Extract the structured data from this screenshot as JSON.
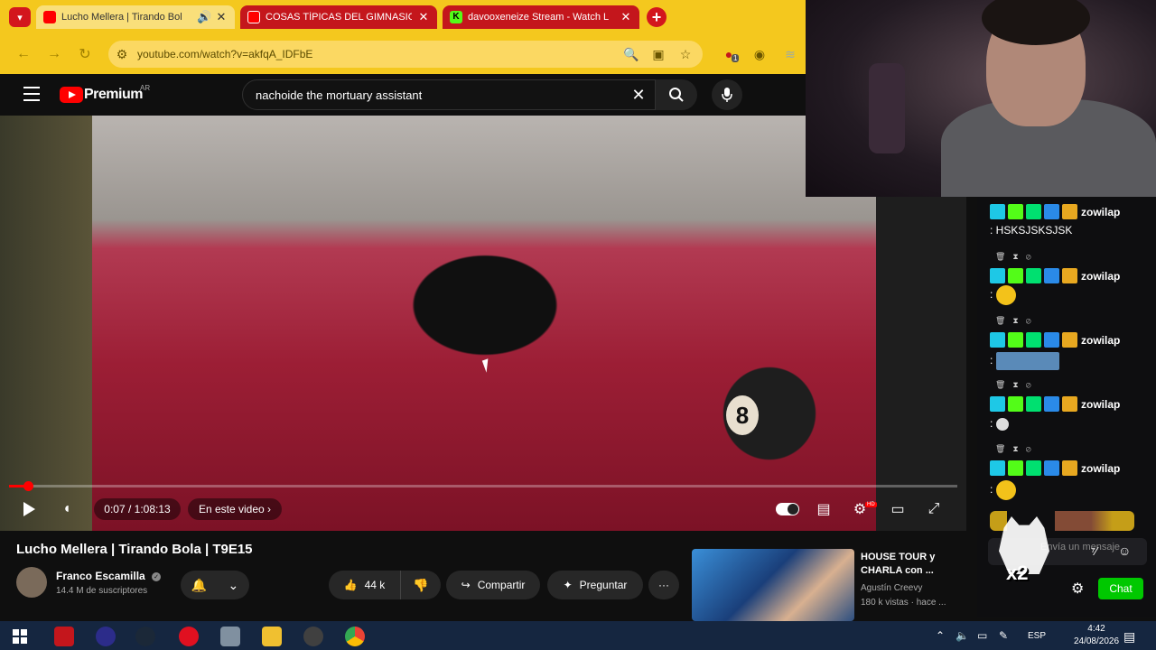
{
  "browser": {
    "tabs": [
      {
        "title": "Lucho Mellera | Tirando Bol",
        "close": "✕"
      },
      {
        "title": "COSAS TÍPICAS DEL GIMNASIO",
        "close": "✕"
      },
      {
        "title": "davooxeneize Stream - Watch L",
        "close": "✕"
      }
    ],
    "new_tab": "+",
    "url": "youtube.com/watch?v=akfqA_IDFbE",
    "extension_badge": "1"
  },
  "youtube": {
    "logo": "Premium",
    "region": "AR",
    "search_value": "nachoide the mortuary assistant",
    "clear_icon": "✕"
  },
  "player": {
    "time": "0:07 / 1:08:13",
    "chapters_label": "En este video",
    "progress": 0.0017,
    "ball_number": "8",
    "hd_badge": "HD"
  },
  "video": {
    "title": "Lucho Mellera | Tirando Bola | T9E15",
    "channel": "Franco Escamilla",
    "subscribers": "14.4 M de suscriptores",
    "likes": "44 k",
    "share_label": "Compartir",
    "ask_label": "Preguntar",
    "more_label": "···"
  },
  "recommendation": {
    "title": "HOUSE TOUR y CHARLA con ...",
    "channel": "Agustín Creevy",
    "meta": "180 k vistas · hace ..."
  },
  "chat": {
    "messages": [
      {
        "user": "zowilap",
        "text": ": HSKSJSKSJSK"
      },
      {
        "user": "zowilap",
        "text": ":"
      },
      {
        "user": "zowilap",
        "text": ":"
      },
      {
        "user": "zowilap",
        "text": ":"
      },
      {
        "user": "zowilap",
        "text": ":"
      }
    ],
    "input_placeholder": "Envía un mensaje",
    "send_label": "Chat",
    "overlay_text": "x2"
  },
  "taskbar": {
    "language": "ESP",
    "time": "4:42",
    "date": "24/08/2026"
  },
  "colors": {
    "browser_accent": "#f4c81e",
    "youtube_red": "#ff0000",
    "chat_send": "#00c800"
  }
}
